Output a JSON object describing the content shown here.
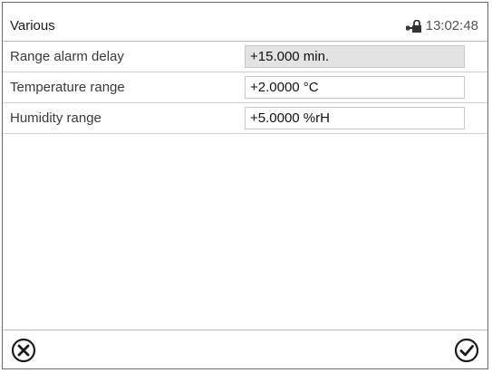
{
  "header": {
    "title": "Various",
    "time": "13:02:48",
    "status_icon": "lock-icon"
  },
  "settings": [
    {
      "label": "Range alarm delay",
      "value": "+15.000 min.",
      "editable": false
    },
    {
      "label": "Temperature range",
      "value": "+2.0000 °C",
      "editable": true
    },
    {
      "label": "Humidity range",
      "value": "+5.0000 %rH",
      "editable": true
    }
  ],
  "footer": {
    "cancel_icon": "cancel-icon",
    "confirm_icon": "confirm-icon"
  }
}
